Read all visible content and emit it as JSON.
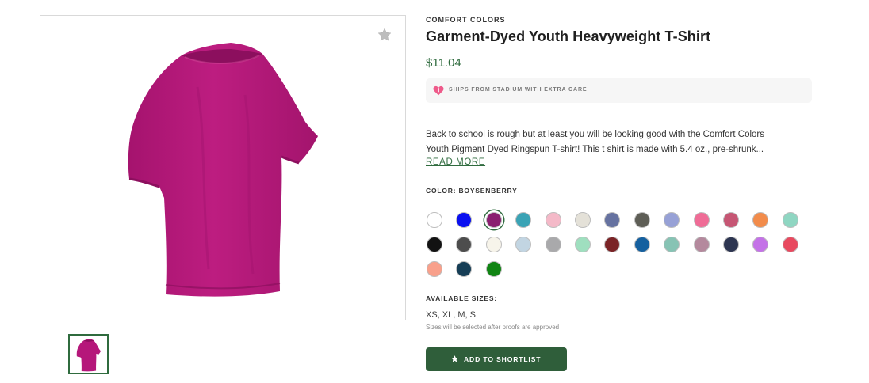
{
  "product": {
    "brand": "COMFORT COLORS",
    "title": "Garment-Dyed Youth Heavyweight T-Shirt",
    "price": "$11.04"
  },
  "ships_banner": {
    "icon": "heart-icon",
    "text": "SHIPS FROM STADIUM WITH EXTRA CARE"
  },
  "description": {
    "line1": "Back to school is rough but at least you will be looking good with the Comfort Colors",
    "line2": "Youth Pigment Dyed Ringspun T-shirt! This t shirt is made with 5.4 oz., pre-shrunk...",
    "read_more": "READ MORE"
  },
  "color": {
    "label": "COLOR: BOYSENBERRY",
    "selected_index": 2,
    "swatches": [
      "#ffffff",
      "#0a10f0",
      "#8a2070",
      "#3aa3b5",
      "#f4b9c8",
      "#e4e1d8",
      "#6672a0",
      "#5e5e56",
      "#97a1d6",
      "#ef6c96",
      "#c65674",
      "#f28c4b",
      "#8fd6c2",
      "#121212",
      "#4d4d4d",
      "#f7f4ea",
      "#c2d5e2",
      "#a9a9ab",
      "#9fdfbf",
      "#7a2326",
      "#15609f",
      "#87c3b4",
      "#b4899d",
      "#2d3551",
      "#c472e7",
      "#e8495f",
      "#f8a08b",
      "#163e56",
      "#108413"
    ]
  },
  "sizes": {
    "label": "AVAILABLE SIZES:",
    "value": "XS, XL, M, S",
    "note": "Sizes will be selected after proofs are approved"
  },
  "actions": {
    "shortlist_label": "ADD TO SHORTLIST"
  },
  "colors": {
    "accent": "#2f6b3e",
    "button": "#2f5e3a",
    "shirt": "#b5177a"
  }
}
